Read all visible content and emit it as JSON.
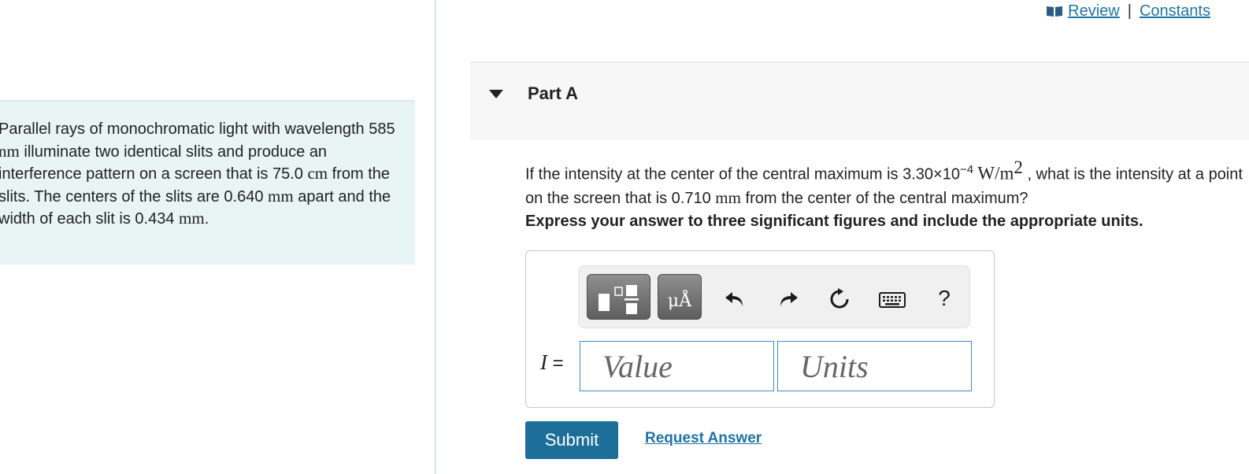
{
  "problem": {
    "t1": "Parallel rays of monochromatic light with wavelength 585 ",
    "u1": "nm",
    "t2": " illuminate two identical slits and produce an interference pattern on a screen that is 75.0 ",
    "u2": "cm",
    "t3": " from the slits. The centers of the slits are 0.640 ",
    "u3": "mm",
    "t4": " apart and the width of each slit is 0.434 ",
    "u4": "mm",
    "t5": "."
  },
  "header": {
    "review_label": "Review",
    "separator": "|",
    "constants_label": "Constants",
    "book_icon": "book-icon"
  },
  "part": {
    "title": "Part A",
    "caret_icon": "caret-down-icon"
  },
  "question": {
    "q1": "If the intensity at the center of the central maximum is 3.30×10",
    "q_exp": "−4",
    "q_unit_w": " W/m",
    "q_unit_exp": "2",
    "q2": " , what is the intensity at a point on the screen that is 0.710 ",
    "q_unit_mm": "mm",
    "q3": " from the center of the central maximum?",
    "instruction": "Express your answer to three significant figures and include the appropriate units."
  },
  "answer": {
    "variable": "I",
    "equals": " =",
    "value_placeholder": "Value",
    "units_placeholder": "Units",
    "toolbar": {
      "units_glyph": "μÅ",
      "help_glyph": "?",
      "icons": [
        "templates-icon",
        "units-icon",
        "undo-icon",
        "redo-icon",
        "reset-icon",
        "keyboard-icon",
        "help-icon"
      ]
    }
  },
  "actions": {
    "submit_label": "Submit",
    "request_label": "Request Answer"
  },
  "colors": {
    "accent": "#1e6e9a",
    "link": "#1e73a8",
    "problem_bg": "#e9f4f5",
    "input_border": "#3d8cbd"
  }
}
